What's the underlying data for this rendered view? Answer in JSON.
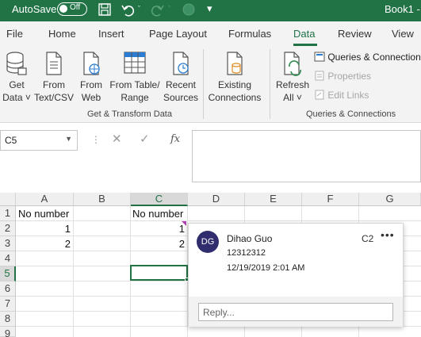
{
  "titlebar": {
    "autosave_label": "AutoSave",
    "autosave_state": "Off",
    "book_title": "Book1 -",
    "bg_color": "#217346"
  },
  "tabs": [
    "File",
    "Home",
    "Insert",
    "Page Layout",
    "Formulas",
    "Data",
    "Review",
    "View"
  ],
  "active_tab": "Data",
  "ribbon": {
    "get_transform": {
      "buttons": [
        {
          "line1": "Get",
          "line2": "Data ˅",
          "icon": "database-icon"
        },
        {
          "line1": "From",
          "line2": "Text/CSV",
          "icon": "text-file-icon"
        },
        {
          "line1": "From",
          "line2": "Web",
          "icon": "web-icon"
        },
        {
          "line1": "From Table/",
          "line2": "Range",
          "icon": "table-icon"
        },
        {
          "line1": "Recent",
          "line2": "Sources",
          "icon": "recent-sources-icon"
        },
        {
          "line1": "Existing",
          "line2": "Connections",
          "icon": "existing-connections-icon"
        }
      ],
      "label": "Get & Transform Data"
    },
    "queries": {
      "refresh_line1": "Refresh",
      "refresh_line2": "All ˅",
      "queries_connections": "Queries & Connections",
      "properties": "Properties",
      "edit_links": "Edit Links",
      "label": "Queries & Connections"
    }
  },
  "formula_bar": {
    "name_box": "C5",
    "fx": "fx",
    "value": ""
  },
  "grid": {
    "columns": [
      "A",
      "B",
      "C",
      "D",
      "E",
      "F",
      "G"
    ],
    "selected_column": "C",
    "rows": [
      "1",
      "2",
      "3",
      "4",
      "5",
      "6",
      "7",
      "8",
      "9"
    ],
    "selected_row": "5",
    "cells": {
      "A1": "No number",
      "C1": "No number",
      "A2": "1",
      "C2": "1",
      "A3": "2",
      "C3": "2"
    }
  },
  "comment": {
    "initials": "DG",
    "author": "Dihao Guo",
    "cell_ref": "C2",
    "more": "•••",
    "text": "12312312",
    "timestamp": "12/19/2019 2:01 AM",
    "reply_placeholder": "Reply..."
  }
}
